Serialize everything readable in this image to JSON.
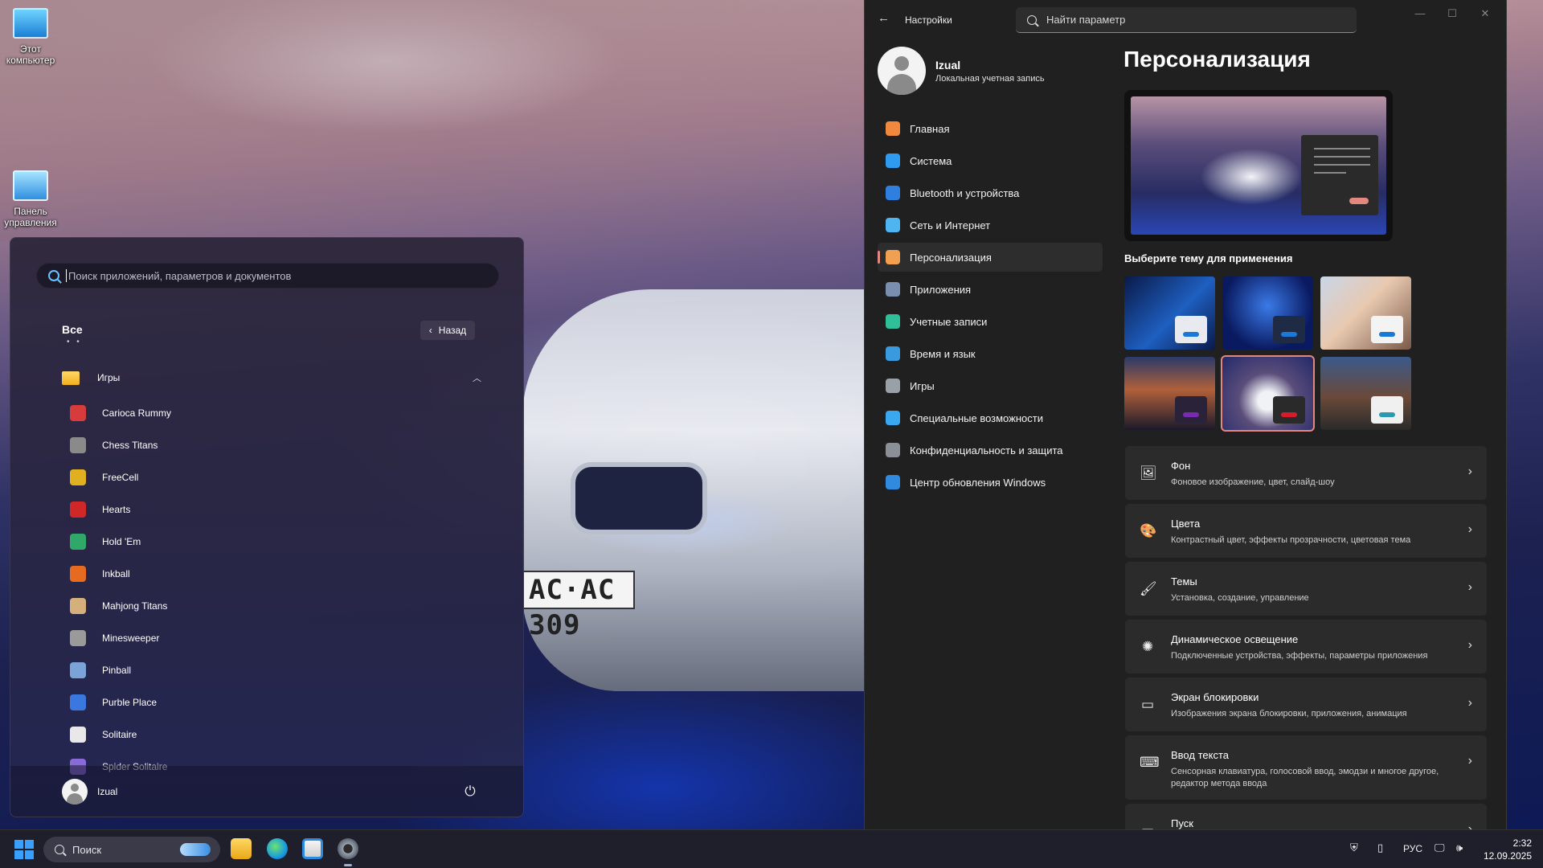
{
  "desktop": {
    "icons": [
      {
        "label": "Этот компьютер",
        "icon": "computer-icon"
      },
      {
        "label": "Панель управления",
        "icon": "control-panel-icon"
      }
    ],
    "wallpaper_plate": "AC·AC 309"
  },
  "start_menu": {
    "search_placeholder": "Поиск приложений, параметров и документов",
    "all_label": "Все",
    "all_dots": "• •",
    "back_label": "Назад",
    "folder": {
      "label": "Игры",
      "expanded": true
    },
    "apps": [
      {
        "label": "Carioca Rummy",
        "color": "#d83b3b"
      },
      {
        "label": "Chess Titans",
        "color": "#8a8a8a"
      },
      {
        "label": "FreeCell",
        "color": "#e0b020"
      },
      {
        "label": "Hearts",
        "color": "#d02828"
      },
      {
        "label": "Hold 'Em",
        "color": "#2fa86a"
      },
      {
        "label": "Inkball",
        "color": "#e66a1f"
      },
      {
        "label": "Mahjong Titans",
        "color": "#d6b07a"
      },
      {
        "label": "Minesweeper",
        "color": "#9a9a9a"
      },
      {
        "label": "Pinball",
        "color": "#7aa3d8"
      },
      {
        "label": "Purble Place",
        "color": "#3a78e0"
      },
      {
        "label": "Solitaire",
        "color": "#e8e8e8"
      },
      {
        "label": "Spider Solitaire",
        "color": "#8a6ad8"
      }
    ],
    "user_name": "Izual",
    "power_glyph": "⏻"
  },
  "settings": {
    "window_title": "Настройки",
    "search_placeholder": "Найти параметр",
    "profile": {
      "name": "Izual",
      "account_type": "Локальная учетная запись"
    },
    "nav": [
      {
        "label": "Главная",
        "icon": "home-icon",
        "color": "#f0883e",
        "active": false
      },
      {
        "label": "Система",
        "icon": "monitor-icon",
        "color": "#2f9bf0",
        "active": false
      },
      {
        "label": "Bluetooth и устройства",
        "icon": "bluetooth-icon",
        "color": "#2f7fe0",
        "active": false
      },
      {
        "label": "Сеть и Интернет",
        "icon": "wifi-icon",
        "color": "#4fb5f0",
        "active": false
      },
      {
        "label": "Персонализация",
        "icon": "brush-icon",
        "color": "#f0a050",
        "active": true
      },
      {
        "label": "Приложения",
        "icon": "apps-icon",
        "color": "#7a8fb0",
        "active": false
      },
      {
        "label": "Учетные записи",
        "icon": "person-icon",
        "color": "#2fc09a",
        "active": false
      },
      {
        "label": "Время и язык",
        "icon": "globe-clock-icon",
        "color": "#3a9ae0",
        "active": false
      },
      {
        "label": "Игры",
        "icon": "gamepad-icon",
        "color": "#9aa0a8",
        "active": false
      },
      {
        "label": "Специальные возможности",
        "icon": "accessibility-icon",
        "color": "#3aa8f0",
        "active": false
      },
      {
        "label": "Конфиденциальность и защита",
        "icon": "shield-icon",
        "color": "#8a8f98",
        "active": false
      },
      {
        "label": "Центр обновления Windows",
        "icon": "update-icon",
        "color": "#2f8ae0",
        "active": false
      }
    ],
    "page_title": "Персонализация",
    "theme_label": "Выберите тему для применения",
    "themes": [
      {
        "name": "windows-light-theme",
        "bg": "linear-gradient(135deg,#0a1a4a,#1e5fc0 55%,#0a1a4a)",
        "chip": "#e8eaf0",
        "bar": "#1a78d8",
        "selected": false
      },
      {
        "name": "windows-dark-theme",
        "bg": "radial-gradient(circle at 50% 40%,#3a7ae8,#0a1a60 70%)",
        "chip": "#1f2a44",
        "bar": "#1a78d8",
        "selected": false
      },
      {
        "name": "glow-theme",
        "bg": "linear-gradient(135deg,#c9d6e8,#e8c9b0 45%,#7a5a48)",
        "chip": "#f3f3f3",
        "bar": "#1a78d8",
        "selected": false
      },
      {
        "name": "sunset-theme",
        "bg": "linear-gradient(180deg,#2a3a6a,#b0603a 45%,#1a1a2a)",
        "chip": "#2a2238",
        "bar": "#7a2ab0",
        "selected": false
      },
      {
        "name": "car-theme",
        "bg": "radial-gradient(ellipse at 50% 60%,#f0f2f6 15%,#5a4d7a 45%,#23296a)",
        "chip": "#2a2a2a",
        "bar": "#d81b2a",
        "selected": true
      },
      {
        "name": "coast-theme",
        "bg": "linear-gradient(180deg,#3a5a8a,#6a4a3a 55%,#2a2a2a)",
        "chip": "#f0f0f0",
        "bar": "#2a9ab0",
        "selected": false
      }
    ],
    "cards": [
      {
        "icon": "image-icon",
        "glyph": "🖼",
        "title": "Фон",
        "subtitle": "Фоновое изображение, цвет, слайд-шоу"
      },
      {
        "icon": "palette-icon",
        "glyph": "🎨",
        "title": "Цвета",
        "subtitle": "Контрастный цвет, эффекты прозрачности, цветовая тема"
      },
      {
        "icon": "brush-icon",
        "glyph": "🖌",
        "title": "Темы",
        "subtitle": "Установка, создание, управление"
      },
      {
        "icon": "sun-icon",
        "glyph": "✺",
        "title": "Динамическое освещение",
        "subtitle": "Подключенные устройства, эффекты, параметры приложения"
      },
      {
        "icon": "lock-screen-icon",
        "glyph": "▭",
        "title": "Экран блокировки",
        "subtitle": "Изображения экрана блокировки, приложения, анимация"
      },
      {
        "icon": "keyboard-icon",
        "glyph": "⌨",
        "title": "Ввод текста",
        "subtitle": "Сенсорная клавиатура, голосовой ввод, эмодзи и многое другое, редактор метода ввода"
      },
      {
        "icon": "start-icon",
        "glyph": "▭",
        "title": "Пуск",
        "subtitle": ""
      }
    ]
  },
  "taskbar": {
    "search_placeholder": "Поиск",
    "language": "РУС",
    "time": "2:32",
    "date": "12.09.2025"
  }
}
